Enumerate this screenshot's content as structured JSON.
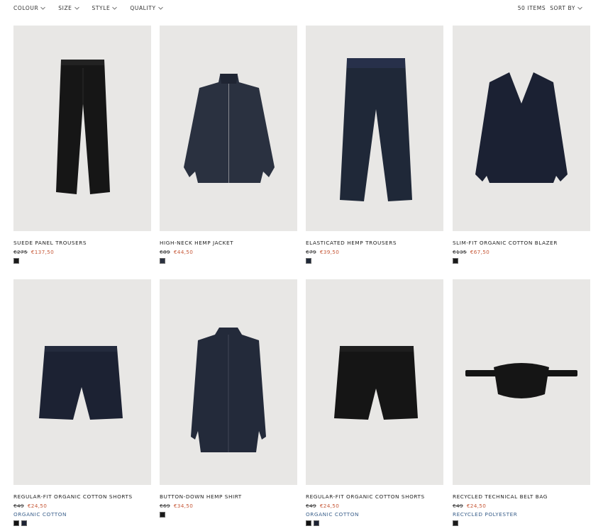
{
  "filters": [
    {
      "label": "COLOUR"
    },
    {
      "label": "SIZE"
    },
    {
      "label": "STYLE"
    },
    {
      "label": "QUALITY"
    }
  ],
  "item_count": "50 ITEMS",
  "sort_label": "SORT BY",
  "products": [
    {
      "name": "SUEDE PANEL TROUSERS",
      "old_price": "€275",
      "sale_price": "€137,50",
      "material": "",
      "swatches": [
        "#1a1a1a"
      ],
      "icon": "trousers-black"
    },
    {
      "name": "HIGH-NECK HEMP JACKET",
      "old_price": "€89",
      "sale_price": "€44,50",
      "material": "",
      "swatches": [
        "#2a3140"
      ],
      "icon": "jacket-navy"
    },
    {
      "name": "ELASTICATED HEMP TROUSERS",
      "old_price": "€79",
      "sale_price": "€39,50",
      "material": "",
      "swatches": [
        "#1f2838"
      ],
      "icon": "trousers-navy"
    },
    {
      "name": "SLIM-FIT ORGANIC COTTON BLAZER",
      "old_price": "€135",
      "sale_price": "€67,50",
      "material": "",
      "swatches": [
        "#1a1a1a"
      ],
      "icon": "blazer-navy"
    },
    {
      "name": "REGULAR-FIT ORGANIC COTTON SHORTS",
      "old_price": "€49",
      "sale_price": "€24,50",
      "material": "ORGANIC COTTON",
      "swatches": [
        "#111111",
        "#1c2233"
      ],
      "icon": "shorts-navy"
    },
    {
      "name": "BUTTON-DOWN HEMP SHIRT",
      "old_price": "€69",
      "sale_price": "€34,50",
      "material": "",
      "swatches": [
        "#1a1a1a"
      ],
      "icon": "shirt-navy"
    },
    {
      "name": "REGULAR-FIT ORGANIC COTTON SHORTS",
      "old_price": "€49",
      "sale_price": "€24,50",
      "material": "ORGANIC COTTON",
      "swatches": [
        "#111111",
        "#1c2233"
      ],
      "icon": "shorts-black"
    },
    {
      "name": "RECYCLED TECHNICAL BELT BAG",
      "old_price": "€49",
      "sale_price": "€24,50",
      "material": "RECYCLED POLYESTER",
      "swatches": [
        "#1a1a1a"
      ],
      "icon": "belt-bag-black"
    }
  ]
}
